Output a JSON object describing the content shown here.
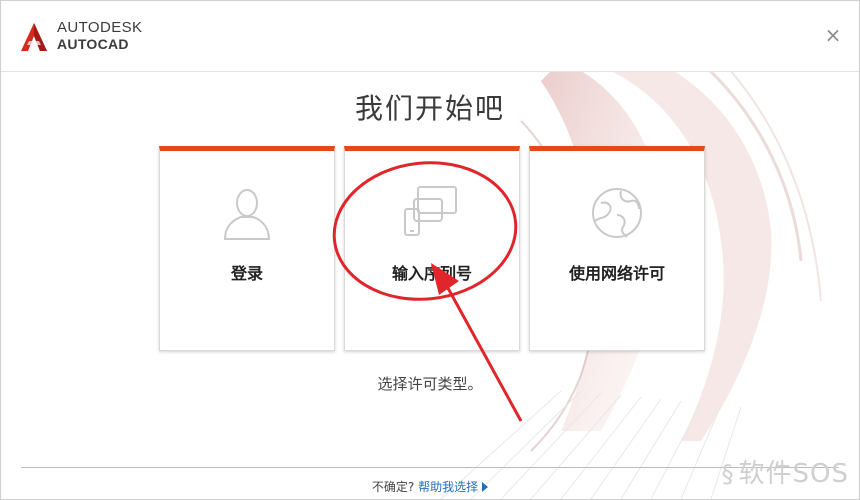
{
  "header": {
    "brand_line1": "AUTODESK",
    "brand_line2": "AUTOCAD",
    "brand_mark": "A",
    "close_glyph": "×"
  },
  "main": {
    "heading": "我们开始吧",
    "cards": [
      {
        "label": "登录",
        "icon": "user-silhouette-icon"
      },
      {
        "label": "输入序列号",
        "icon": "devices-icon"
      },
      {
        "label": "使用网络许可",
        "icon": "globe-network-icon"
      }
    ],
    "hint": "选择许可类型。"
  },
  "footer": {
    "question": "不确定?",
    "help_link": "帮助我选择"
  },
  "watermark": {
    "text": "软件SOS",
    "icon_glyph": "§"
  },
  "colors": {
    "accent": "#e8461b",
    "link": "#1f6fbf",
    "annotation": "#e0262a"
  }
}
